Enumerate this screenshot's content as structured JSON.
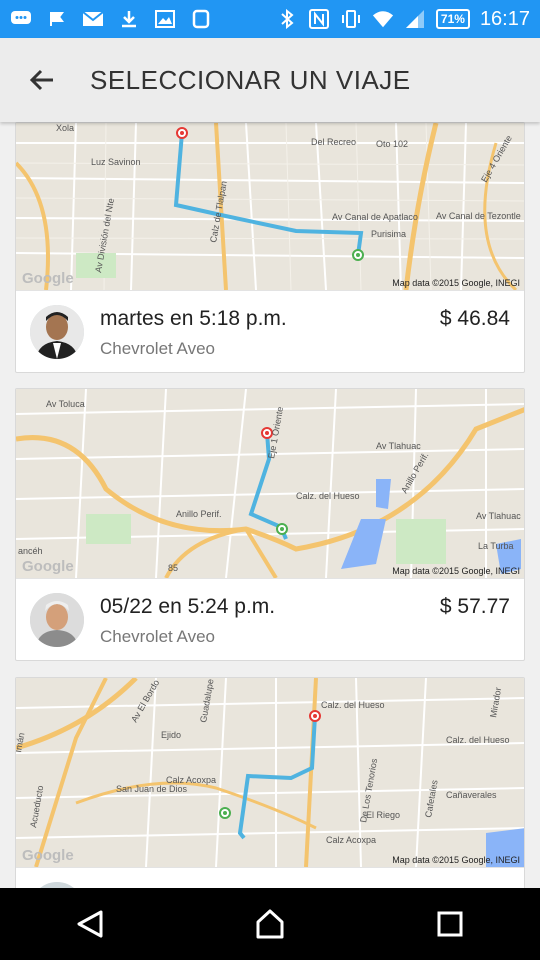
{
  "status_bar": {
    "battery": "71%",
    "time": "16:17",
    "icons": [
      "chat-icon",
      "flag-icon",
      "mail-icon",
      "download-icon",
      "image-icon",
      "phone-icon",
      "bluetooth-icon",
      "nfc-icon",
      "vibrate-icon",
      "wifi-icon",
      "signal-icon"
    ]
  },
  "app_bar": {
    "back_icon": "arrow-back-icon",
    "title": "SELECCIONAR UN VIAJE"
  },
  "trips": [
    {
      "date": "martes en 5:18 p.m.",
      "car": "Chevrolet Aveo",
      "price": "$ 46.84",
      "map_attribution": "Map data ©2015 Google, INEGI",
      "map_labels": [
        "Xola",
        "Del Recreo",
        "Oto 102",
        "Luz Savinon",
        "Av Canal de Apatlaco",
        "Av Canal de Tezontle",
        "Calz de Tlalpan",
        "Purisima",
        "Eje 4 Oriente",
        "Av División del Nte"
      ]
    },
    {
      "date": "05/22 en 5:24 p.m.",
      "car": "Chevrolet Aveo",
      "price": "$ 57.77",
      "map_attribution": "Map data ©2015 Google, INEGI",
      "map_labels": [
        "Av Toluca",
        "Av Tlahuac",
        "Calz. del Hueso",
        "Anillo Perif.",
        "Eje 1 Oriente",
        "La Turba",
        "ancéh",
        "85"
      ]
    },
    {
      "date": "",
      "car": "",
      "price": "",
      "map_attribution": "Map data ©2015 Google, INEGI",
      "map_labels": [
        "Calz. del Hueso",
        "Av El Bordo",
        "Ejido",
        "Guadalupe",
        "Calz Acoxpa",
        "San Juan de Dios",
        "De Los Tenorios",
        "El Riego",
        "Cafetales",
        "Cañaverales",
        "Mirador",
        "Calz. del Hueso",
        "Acueducto",
        "Imán"
      ]
    }
  ],
  "nav_bar": {
    "back": "back-triangle-icon",
    "home": "home-icon",
    "recents": "recents-icon"
  },
  "colors": {
    "status_bar": "#2196f3",
    "route": "#4fb3e0",
    "map_bg": "#e9e5dc",
    "road_major": "#f4c46e"
  }
}
